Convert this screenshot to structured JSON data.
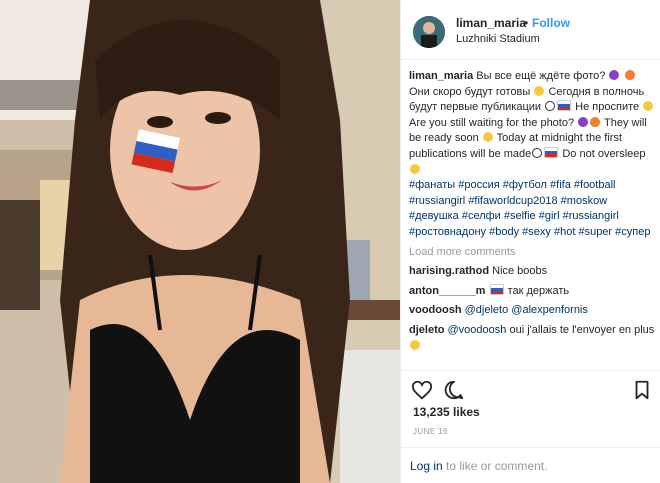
{
  "post": {
    "username": "liman_maria",
    "dot": "•",
    "follow_label": "Follow",
    "location": "Luzhniki Stadium",
    "caption": {
      "username": "liman_maria",
      "part1": "Вы все ещё ждёте фото?",
      "part2": "Они скоро будут готовы",
      "part3": "Сегодня в полночь будут первые публикации",
      "part4": "Не проспите",
      "part5": "Are you still waiting for the photo?",
      "part6": "They will be ready soon",
      "part7": "Today at midnight the first publications will be made",
      "part8": "Do not oversleep"
    },
    "hashtags": [
      "#фанаты",
      "#россия",
      "#футбол",
      "#fifa",
      "#football",
      "#russiangirl",
      "#fifaworldcup2018",
      "#moskow",
      "#девушка",
      "#селфи",
      "#selfie",
      "#girl",
      "#russiangirl",
      "#ростовнадону",
      "#body",
      "#sexy",
      "#hot",
      "#super",
      "#супер"
    ],
    "load_more": "Load more comments",
    "comments": [
      {
        "user": "harising.rathod",
        "text": "Nice boobs"
      },
      {
        "user": "anton______m",
        "text": "так держать"
      },
      {
        "user": "voodoosh",
        "mention1": "@djeleto",
        "mention2": "@alexpenfornis"
      },
      {
        "user": "djeleto",
        "mention": "@voodoosh",
        "text": "oui j'allais te l'envoyer en plus"
      }
    ],
    "likes": "13,235 likes",
    "date": "JUNE 16",
    "footer": {
      "login": "Log in",
      "rest": "to like or comment."
    }
  },
  "icons": {
    "like": "heart-icon",
    "comment": "comment-bubble-icon",
    "save": "bookmark-icon",
    "emoji_devil": "smiling-devil-emoji",
    "emoji_fire": "fire-emoji",
    "emoji_smile": "smile-emoji",
    "emoji_ball": "soccer-ball-emoji",
    "emoji_flag": "russia-flag-emoji"
  },
  "colors": {
    "link_blue": "#3897f0",
    "hashtag_blue": "#003569",
    "muted_gray": "#999999",
    "text_dark": "#262626"
  }
}
